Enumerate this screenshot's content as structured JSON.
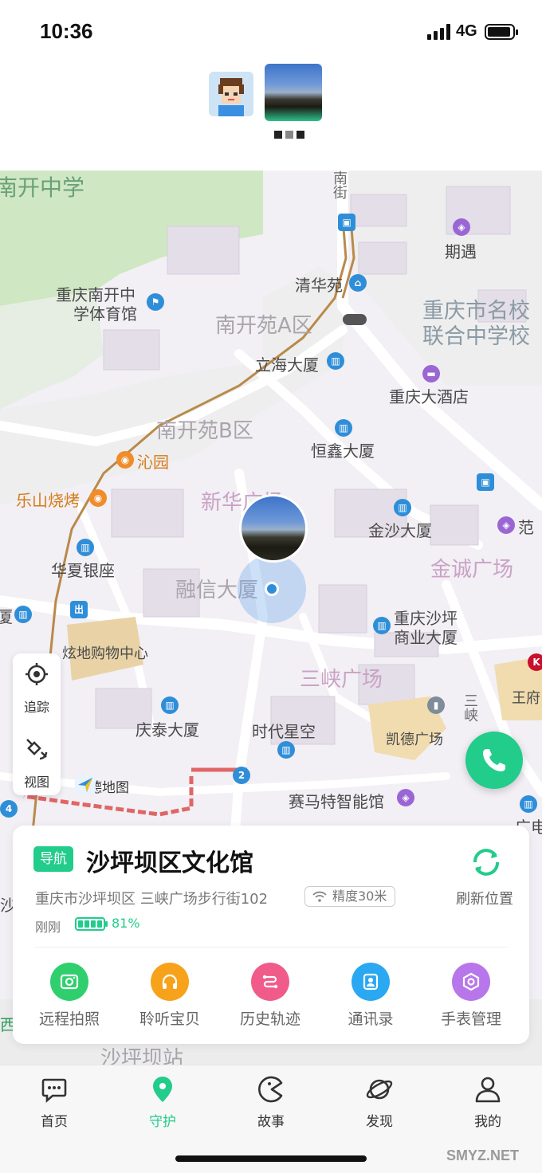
{
  "status_bar": {
    "time": "10:36",
    "network": "4G"
  },
  "map": {
    "labels": {
      "nankai_school": "南开中学",
      "nankai_stadium_1": "重庆南开中",
      "nankai_stadium_2": "学体育馆",
      "nankaiyuan_a": "南开苑A区",
      "nankaiyuan_b": "南开苑B区",
      "qinghuayuan": "清华苑",
      "qiyu": "期遇",
      "mingxiao_1": "重庆市名校",
      "mingxiao_2": "联合中学校",
      "lihai": "立海大厦",
      "chongqing_hotel": "重庆大酒店",
      "qinyuan": "沁园",
      "hengxin": "恒鑫大厦",
      "leshan_bbq": "乐山烧烤",
      "xinhua_plaza": "新华广场",
      "jinsha": "金沙大厦",
      "fan": "范",
      "huaxia_bank": "华夏银座",
      "jincheng_plaza": "金诚广场",
      "rongxin": "融信大厦",
      "xia": "厦",
      "shapingba_comm_1": "重庆沙坪",
      "shapingba_comm_2": "商业大厦",
      "xuandi": "炫地购物中心",
      "sanxia_plaza": "三峡广场",
      "wangfu": "王府",
      "sanxia_street": "三峡",
      "qingtai": "庆泰大厦",
      "shidai_star": "时代星空",
      "kaide_plaza": "凯德广场",
      "saimate": "赛马特智能馆",
      "guangdian": "广电",
      "shapingba_station": "沙坪坝站",
      "xi": "西",
      "sha": "沙",
      "south_street": "南街",
      "exit_badge": "出",
      "line_num_2": "2",
      "line_num_4": "4"
    },
    "amap_logo": "高德地图"
  },
  "controls": {
    "track_label": "追踪",
    "view_label": "视图"
  },
  "card": {
    "nav_badge": "导航",
    "place_name": "沙坪坝区文化馆",
    "address": "重庆市沙坪坝区 三峡广场步行街102",
    "accuracy": "精度30米",
    "updated": "刚刚",
    "battery": "81%",
    "battery_level": 0.81,
    "refresh_label": "刷新位置",
    "actions": [
      {
        "label": "远程拍照",
        "icon": "camera-icon",
        "color": "#2fcf6d"
      },
      {
        "label": "聆听宝贝",
        "icon": "headphones-icon",
        "color": "#f7a21b"
      },
      {
        "label": "历史轨迹",
        "icon": "route-icon",
        "color": "#f05b8a"
      },
      {
        "label": "通讯录",
        "icon": "contacts-icon",
        "color": "#2aa8f2"
      },
      {
        "label": "手表管理",
        "icon": "settings-hex-icon",
        "color": "#b777ea"
      }
    ]
  },
  "tabs": [
    {
      "label": "首页",
      "icon": "chat-icon",
      "active": false
    },
    {
      "label": "守护",
      "icon": "location-pin-icon",
      "active": true
    },
    {
      "label": "故事",
      "icon": "pacman-icon",
      "active": false
    },
    {
      "label": "发现",
      "icon": "planet-icon",
      "active": false
    },
    {
      "label": "我的",
      "icon": "person-icon",
      "active": false
    }
  ],
  "colors": {
    "accent": "#22cc8b"
  },
  "watermark": "SMYZ.NET"
}
